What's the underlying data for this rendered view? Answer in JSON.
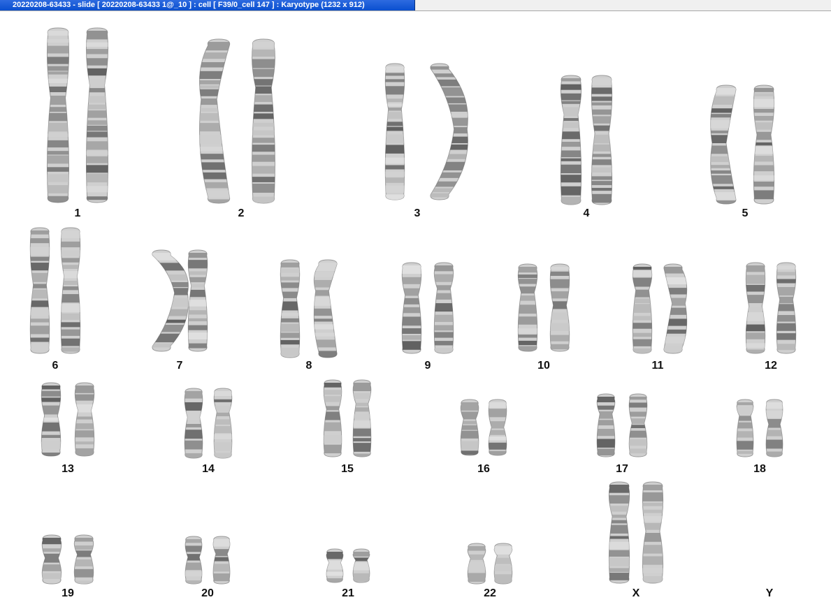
{
  "window": {
    "title": "20220208-63433 - slide [ 20220208-63433 1@_10 ] : cell [ F39/0_cell 147 ] : Karyotype  (1232 x 912)"
  },
  "karyotype": {
    "chromosomes": [
      {
        "label": "1",
        "present": true
      },
      {
        "label": "2",
        "present": true
      },
      {
        "label": "3",
        "present": true
      },
      {
        "label": "4",
        "present": true
      },
      {
        "label": "5",
        "present": true
      },
      {
        "label": "6",
        "present": true
      },
      {
        "label": "7",
        "present": true
      },
      {
        "label": "8",
        "present": true
      },
      {
        "label": "9",
        "present": true
      },
      {
        "label": "10",
        "present": true
      },
      {
        "label": "11",
        "present": true
      },
      {
        "label": "12",
        "present": true
      },
      {
        "label": "13",
        "present": true
      },
      {
        "label": "14",
        "present": true
      },
      {
        "label": "15",
        "present": true
      },
      {
        "label": "16",
        "present": true
      },
      {
        "label": "17",
        "present": true
      },
      {
        "label": "18",
        "present": true
      },
      {
        "label": "19",
        "present": true
      },
      {
        "label": "20",
        "present": true
      },
      {
        "label": "21",
        "present": true
      },
      {
        "label": "22",
        "present": true
      },
      {
        "label": "X",
        "present": true
      },
      {
        "label": "Y",
        "present": false
      }
    ]
  }
}
